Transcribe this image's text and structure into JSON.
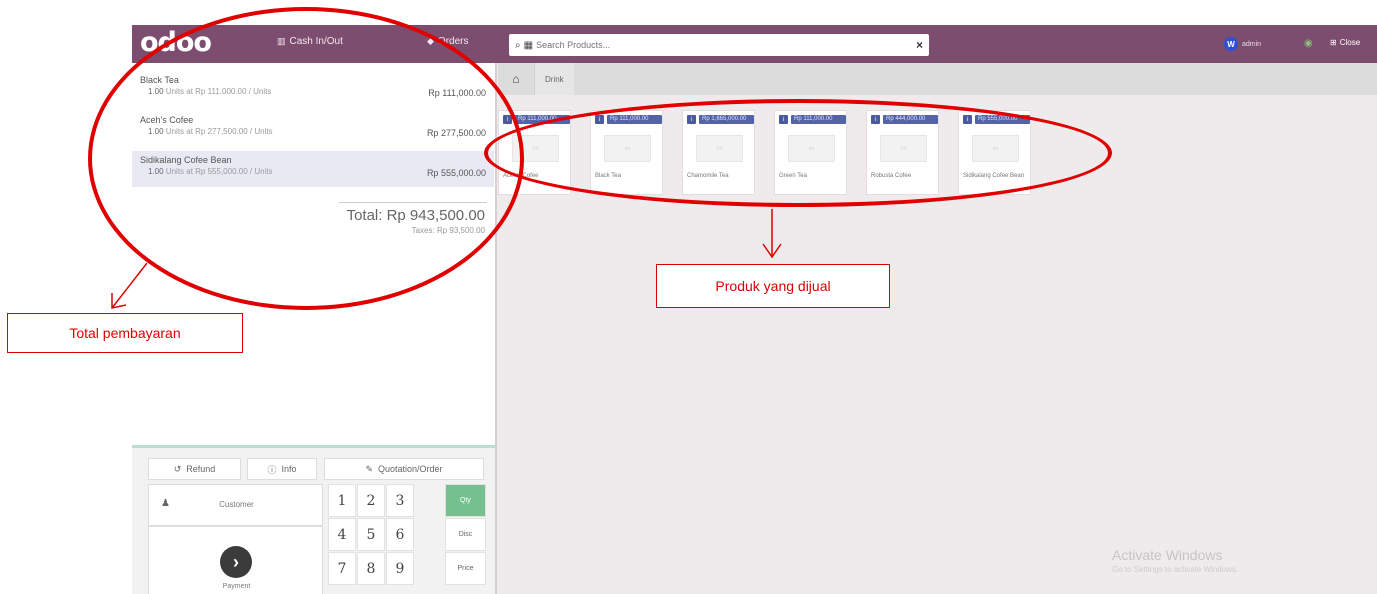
{
  "topbar": {
    "logo": "odoo",
    "cash_label": "Cash In/Out",
    "orders_label": "Orders",
    "search_placeholder": "Search Products...",
    "user_initial": "W",
    "user_name": "admin",
    "close_label": "Close"
  },
  "order": {
    "lines": [
      {
        "name": "Black Tea",
        "qty": "1.00",
        "info": "Units at Rp 111,000.00 / Units",
        "price": "Rp 111,000.00"
      },
      {
        "name": "Aceh's Cofee",
        "qty": "1.00",
        "info": "Units at Rp 277,500.00 / Units",
        "price": "Rp 277,500.00"
      },
      {
        "name": "Sidikalang Cofee Bean",
        "qty": "1.00",
        "info": "Units at Rp 555,000.00 / Units",
        "price": "Rp 555,000.00"
      }
    ],
    "total": "Total: Rp 943,500.00",
    "taxes": "Taxes: Rp 93,500.00"
  },
  "controls": {
    "refund": "Refund",
    "info": "Info",
    "quotation": "Quotation/Order",
    "customer": "Customer",
    "payment": "Payment",
    "keys": [
      "1",
      "2",
      "3",
      "4",
      "5",
      "6",
      "7",
      "8",
      "9"
    ],
    "modes": [
      "Qty",
      "Disc",
      "Price"
    ]
  },
  "breadcrumb": {
    "category": "Drink"
  },
  "products": [
    {
      "price": "Rp 111,000.00",
      "name": "Aceh's Cofee"
    },
    {
      "price": "Rp 111,000.00",
      "name": "Black Tea"
    },
    {
      "price": "Rp 1,665,000.00",
      "name": "Chamomile Tea"
    },
    {
      "price": "Rp 111,000.00",
      "name": "Green Tea"
    },
    {
      "price": "Rp 444,000.00",
      "name": "Robusta Cofee"
    },
    {
      "price": "Rp 555,000.00",
      "name": "Sidikalang Cofee Bean"
    }
  ],
  "watermark": {
    "title": "Activate Windows",
    "sub": "Go to Settings to activate Windows."
  },
  "annotations": {
    "total_label": "Total pembayaran",
    "products_label": "Produk yang dijual"
  },
  "colors": {
    "brand": "#7c4d6f",
    "annotation": "#e00000",
    "qty_active": "#74c08e"
  }
}
